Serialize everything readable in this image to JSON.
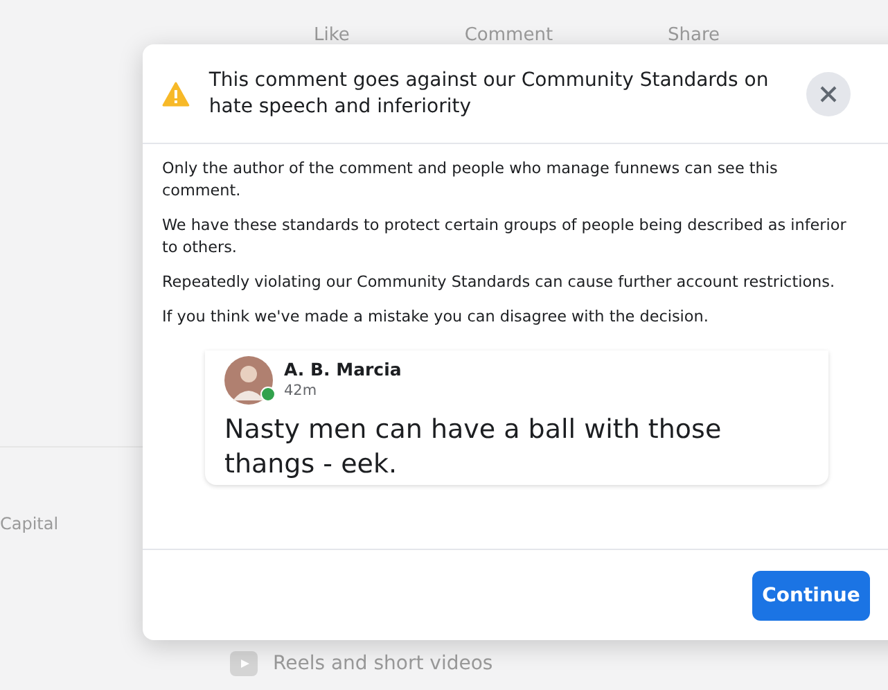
{
  "background": {
    "post_actions": [
      "Like",
      "Comment",
      "Share"
    ],
    "sidebar_item": "Capital",
    "feed_item": "Reels and short videos"
  },
  "dialog": {
    "title": "This comment goes against our Community Standards on hate speech and inferiority",
    "paragraphs": [
      "Only the author of the comment and people who manage funnews can see this comment.",
      "We have these standards to protect certain groups of people being described as inferior to others.",
      "Repeatedly violating our Community Standards can cause further account restrictions.",
      "If you think we've made a mistake you can disagree with the decision."
    ],
    "comment": {
      "author": "A. B. Marcia",
      "time": "42m",
      "online": true,
      "text": "Nasty men can have a ball with those thangs - eek."
    },
    "buttons": [
      "Continue"
    ]
  }
}
